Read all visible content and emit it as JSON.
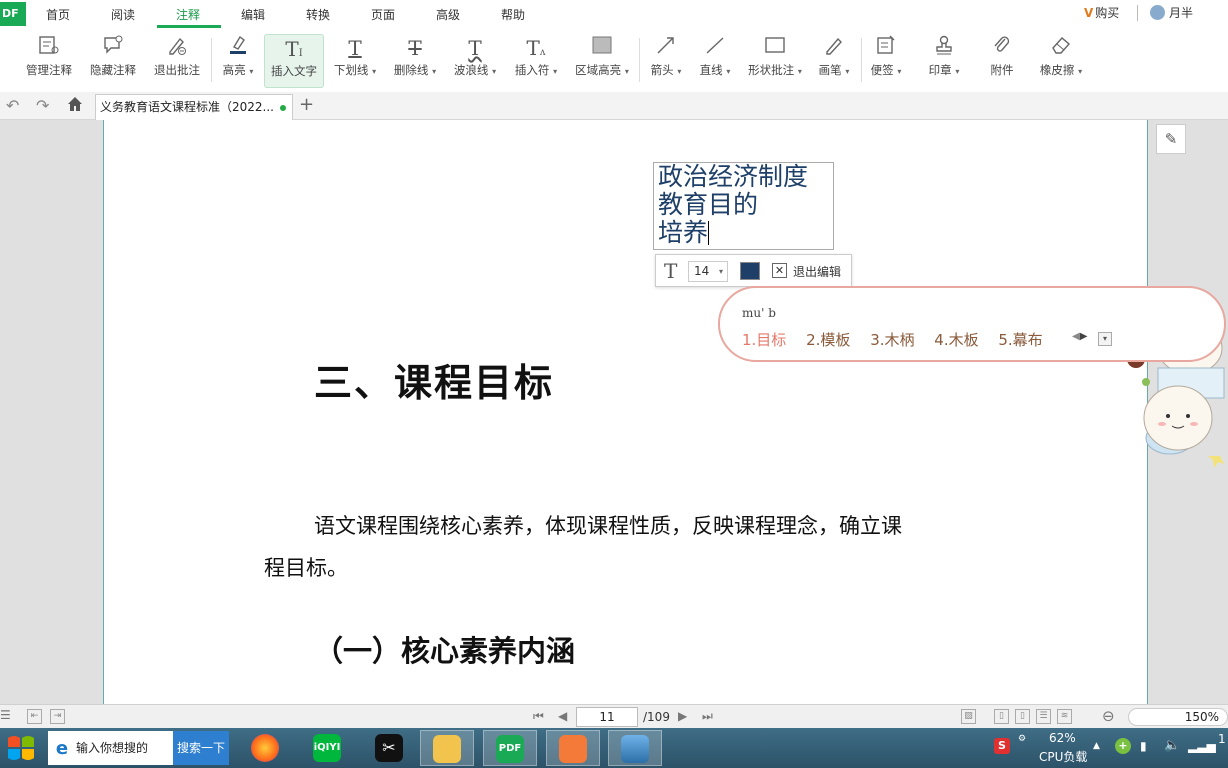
{
  "menubar": {
    "logo": "DF",
    "items": [
      "首页",
      "阅读",
      "注释",
      "编辑",
      "转换",
      "页面",
      "高级",
      "帮助"
    ],
    "active_index": 2,
    "buy": "购买",
    "user": "月半"
  },
  "toolbar": {
    "tools": [
      {
        "label": "管理注释",
        "icon": "manage-annotations-icon"
      },
      {
        "label": "隐藏注释",
        "icon": "hide-annotations-icon"
      },
      {
        "label": "退出批注",
        "icon": "exit-annotate-icon"
      },
      {
        "label": "高亮",
        "icon": "highlight-icon",
        "dropdown": true
      },
      {
        "label": "插入文字",
        "icon": "insert-text-icon",
        "active": true
      },
      {
        "label": "下划线",
        "icon": "underline-icon",
        "dropdown": true
      },
      {
        "label": "删除线",
        "icon": "strikethrough-icon",
        "dropdown": true
      },
      {
        "label": "波浪线",
        "icon": "wavy-line-icon",
        "dropdown": true
      },
      {
        "label": "插入符",
        "icon": "caret-insert-icon",
        "dropdown": true
      },
      {
        "label": "区域高亮",
        "icon": "area-highlight-icon",
        "dropdown": true
      },
      {
        "label": "箭头",
        "icon": "arrow-icon",
        "dropdown": true
      },
      {
        "label": "直线",
        "icon": "line-icon",
        "dropdown": true
      },
      {
        "label": "形状批注",
        "icon": "shape-icon",
        "dropdown": true
      },
      {
        "label": "画笔",
        "icon": "pen-icon",
        "dropdown": true
      },
      {
        "label": "便签",
        "icon": "sticky-note-icon",
        "dropdown": true
      },
      {
        "label": "印章",
        "icon": "stamp-icon",
        "dropdown": true
      },
      {
        "label": "附件",
        "icon": "attachment-icon"
      },
      {
        "label": "橡皮擦",
        "icon": "eraser-icon",
        "dropdown": true
      }
    ]
  },
  "tabbar": {
    "doc_tab": "义务教育语文课程标准（2022..."
  },
  "document": {
    "heading1": "三、课程目标",
    "para_line1": "语文课程围绕核心素养，体现课程性质，反映课程理念，确立课",
    "para_line2": "程目标。",
    "heading2": "（一）核心素养内涵",
    "textbox_lines": [
      "政治经济制度",
      "教育目的",
      "培养"
    ],
    "text_color": "#1e3f68"
  },
  "edit_toolbar": {
    "font_size": "14",
    "exit_label": "退出编辑"
  },
  "ime": {
    "input": "mu' b",
    "candidates": [
      "1.目标",
      "2.模板",
      "3.木柄",
      "4.木板",
      "5.幕布"
    ]
  },
  "statusbar": {
    "current_page": "11",
    "total_pages": "/109",
    "zoom": "150%"
  },
  "taskbar": {
    "search_placeholder": "输入你想搜的",
    "search_button": "搜索一下",
    "apps": [
      "firefox",
      "iqiyi",
      "capcut",
      "file-explorer",
      "pdf",
      "presentation",
      "photos"
    ],
    "pdf_label": "PDF",
    "iqiyi_label": "iQIYI",
    "cpu_percent": "62%",
    "cpu_label": "CPU负载",
    "clock": "1"
  }
}
